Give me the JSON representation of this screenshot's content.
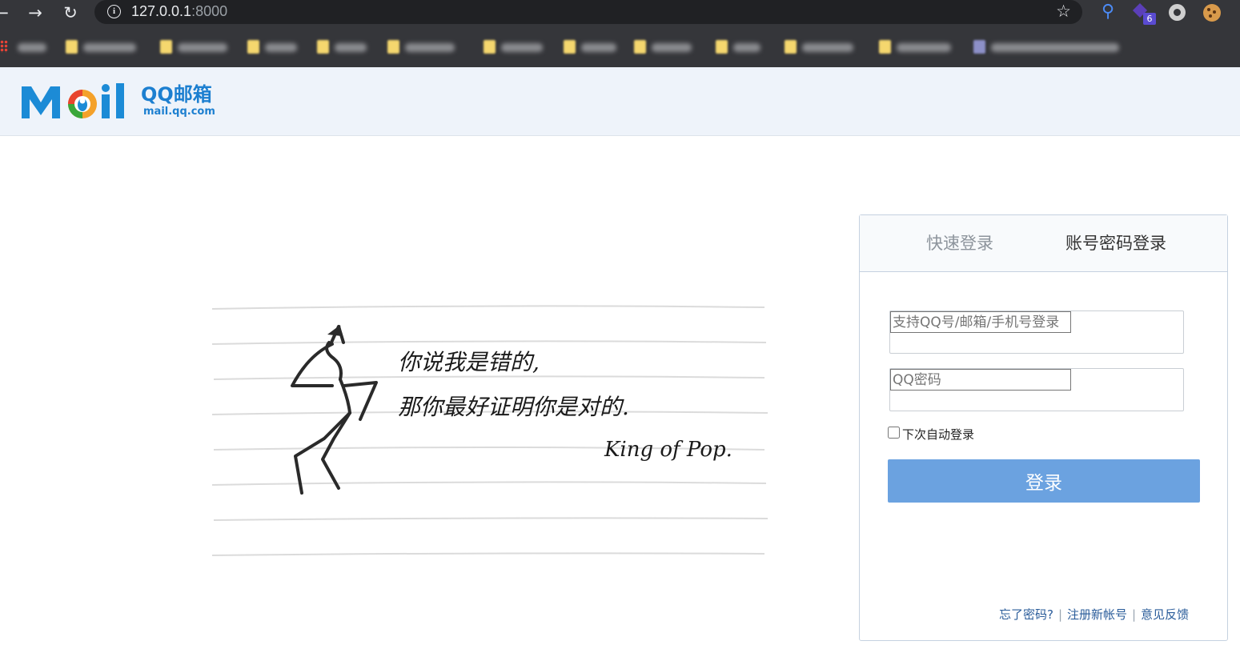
{
  "browser": {
    "url_host": "127.0.0.1",
    "url_port": ":8000",
    "extension_badge": "6"
  },
  "header": {
    "logo_word": "Mail",
    "logo_title": "QQ邮箱",
    "logo_domain": "mail.qq.com"
  },
  "art": {
    "line1": "你说我是错的,",
    "line2": "那你最好证明你是对的.",
    "signature": "King of Pop."
  },
  "login": {
    "tabs": [
      "快速登录",
      "账号密码登录"
    ],
    "active_tab": "账号密码登录",
    "username_placeholder": "支持QQ号/邮箱/手机号登录",
    "password_placeholder": "QQ密码",
    "remember_label": "下次自动登录",
    "submit_label": "登录",
    "links": [
      "忘了密码?",
      "注册新帐号",
      "意见反馈"
    ],
    "button_color": "#6ba2e0"
  }
}
